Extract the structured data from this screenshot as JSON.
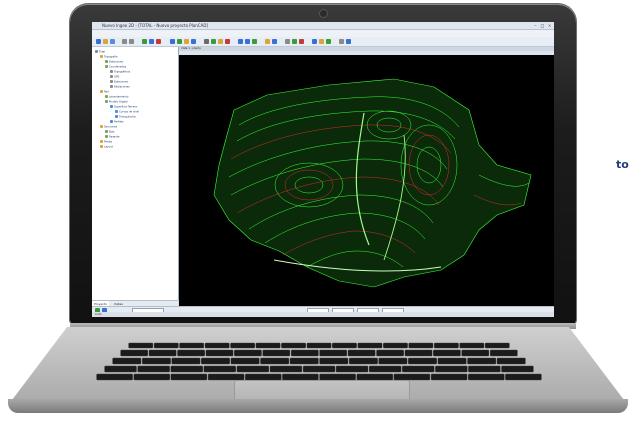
{
  "window": {
    "title": "Nuevo Ingeo 2D - [TOTAL - Nuevo proyecto PlanCAD]",
    "controls": [
      "–",
      "□",
      "×"
    ]
  },
  "menu": [
    "Archivo",
    "Editar",
    "Ver",
    "AutoCAD",
    "Nube",
    "Topografía",
    "Secciones",
    "Terreno",
    "Ventana",
    "Configuración",
    "Herramientas",
    "Utilidades",
    "Ayuda"
  ],
  "tree": {
    "items": [
      {
        "label": "Total",
        "indent": 0,
        "color": "#6d8fbf"
      },
      {
        "label": "Topografía",
        "indent": 1,
        "color": "#d9a43a"
      },
      {
        "label": "Estaciones",
        "indent": 2,
        "color": "#7aa35a"
      },
      {
        "label": "Coordenadas",
        "indent": 2,
        "color": "#7aa35a"
      },
      {
        "label": "Topográficos",
        "indent": 3,
        "color": "#8a8a8a"
      },
      {
        "label": "GPS",
        "indent": 3,
        "color": "#8a8a8a"
      },
      {
        "label": "Estaciones",
        "indent": 3,
        "color": "#8a8a8a"
      },
      {
        "label": "Radiaciones",
        "indent": 3,
        "color": "#8a8a8a"
      },
      {
        "label": "Red",
        "indent": 1,
        "color": "#d9a43a"
      },
      {
        "label": "Levantamiento",
        "indent": 2,
        "color": "#7aa35a"
      },
      {
        "label": "Modelo Digital",
        "indent": 2,
        "color": "#7aa35a"
      },
      {
        "label": "Superficie Terreno",
        "indent": 3,
        "color": "#4a8ed6"
      },
      {
        "label": "Curvas de nivel",
        "indent": 4,
        "color": "#4a8ed6"
      },
      {
        "label": "Triangulación",
        "indent": 4,
        "color": "#4a8ed6"
      },
      {
        "label": "Perfiles",
        "indent": 3,
        "color": "#4a8ed6"
      },
      {
        "label": "Secciones",
        "indent": 1,
        "color": "#d9a43a"
      },
      {
        "label": "Ejes",
        "indent": 2,
        "color": "#7aa35a"
      },
      {
        "label": "Rasante",
        "indent": 2,
        "color": "#7aa35a"
      },
      {
        "label": "Planta",
        "indent": 1,
        "color": "#d9a43a"
      },
      {
        "label": "Layout",
        "indent": 1,
        "color": "#d9a43a"
      }
    ],
    "tabs": [
      "Proyecto",
      "Vistas"
    ]
  },
  "viewport": {
    "tab_label": "Vista 1 - planta"
  },
  "status": {
    "text": "Listo"
  },
  "accent_colors": {
    "contour_primary": "#39ff3a",
    "contour_secondary": "#d62a2a",
    "selection_blue": "#3a6fd8"
  },
  "side_text": "to"
}
